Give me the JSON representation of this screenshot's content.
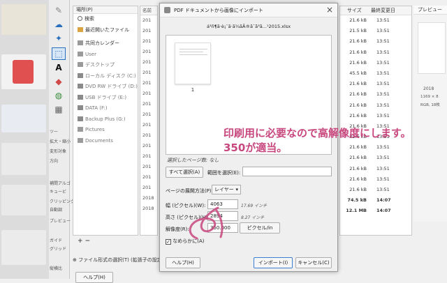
{
  "toolbox": {
    "tool_labels": [
      "A"
    ],
    "options": [
      "ツー",
      "拡大・縮小",
      "変形対象",
      "方向",
      "補間アルゴ",
      "キュービ",
      "クリッピング",
      "自動調",
      "プレビュー",
      "ガイド",
      "グリッド",
      "縦横比"
    ]
  },
  "places": {
    "header": "場所(P)",
    "items": [
      {
        "label": "検索",
        "icon": "search-icon"
      },
      {
        "label": "最近開いたファイル",
        "icon": "recent-icon"
      },
      {
        "label": "共同カレンダー",
        "icon": "folder-icon"
      },
      {
        "label": "User",
        "icon": "folder-icon"
      },
      {
        "label": "デスクトップ",
        "icon": "folder-icon"
      },
      {
        "label": "ローカル ディスク (C:)",
        "icon": "drive-icon"
      },
      {
        "label": "DVD RW ドライブ (D:)",
        "icon": "drive-icon"
      },
      {
        "label": "USB ドライブ (E:)",
        "icon": "drive-icon"
      },
      {
        "label": "DATA (F:)",
        "icon": "drive-icon"
      },
      {
        "label": "Backup Plus (G:)",
        "icon": "drive-icon"
      },
      {
        "label": "Pictures",
        "icon": "folder-icon"
      },
      {
        "label": "Documents",
        "icon": "folder-icon"
      }
    ],
    "add_remove": "+ −"
  },
  "files": {
    "header": "名前",
    "rows": [
      "201",
      "201",
      "201",
      "201",
      "201",
      "201",
      "201",
      "201",
      "201",
      "201",
      "201",
      "201",
      "201",
      "201",
      "201",
      "201",
      "201",
      "2018",
      "2018"
    ]
  },
  "columns": {
    "size_header": "サイズ",
    "modified_header": "最終変更日",
    "rows": [
      [
        "21.6 kB",
        "13:51"
      ],
      [
        "21.5 kB",
        "13:51"
      ],
      [
        "21.6 kB",
        "13:51"
      ],
      [
        "21.6 kB",
        "13:51"
      ],
      [
        "21.6 kB",
        "13:51"
      ],
      [
        "45.5 kB",
        "13:51"
      ],
      [
        "21.6 kB",
        "13:51"
      ],
      [
        "21.6 kB",
        "13:51"
      ],
      [
        "21.6 kB",
        "13:51"
      ],
      [
        "21.6 kB",
        "13:51"
      ],
      [
        "21.6 kB",
        "13:51"
      ],
      [
        "21.6 kB",
        "13:51"
      ],
      [
        "21.6 kB",
        "13:51"
      ],
      [
        "21.6 kB",
        "13:51"
      ],
      [
        "21.6 kB",
        "13:51"
      ],
      [
        "21.6 kB",
        "13:51"
      ],
      [
        "21.6 kB",
        "13:51"
      ],
      [
        "74.5 kB",
        "14:07"
      ],
      [
        "12.1 MB",
        "14:07"
      ]
    ]
  },
  "preview": {
    "header": "プレビュー",
    "lines": [
      "2018",
      "1169 × 8",
      "RGB, 18枚"
    ]
  },
  "dialog": {
    "title": "PDF ドキュメントから画像にインポート",
    "filename": "á³ñ¶ã·è¡¨ã·ã¼ãÃ®ã¯ã³ã...¹2015.xlsx",
    "page_number": "1",
    "selected_pages": "選択したページ数: なし",
    "select_all": "すべて選択(A)",
    "range_label": "範囲を選択(E):",
    "range_value": "",
    "open_pages_label": "ページの展開方法(P)",
    "open_pages_value": "レイヤー",
    "width_label": "幅 (ピクセル)(W):",
    "width_value": "4063",
    "width_units": "17.69 インチ",
    "height_label": "高さ (ピクセル)(H):",
    "height_value": "2894",
    "height_units": "8.27 インチ",
    "resolution_label": "解像度(R):",
    "resolution_value": "350.000",
    "resolution_unit": "ピクセル/in",
    "antialias_label": "なめらかに(A)",
    "help": "ヘルプ(H)",
    "import": "インポート(I)",
    "cancel": "キャンセル(C)"
  },
  "annotation": {
    "line1": "印刷用に必要なので高解像度にします。",
    "line2": "350が適当。",
    "color": "#c7477e"
  },
  "footer": {
    "file_type_label": "ファイル形式の選択(T) (拡張子の設定",
    "help": "ヘルプ(H)"
  }
}
